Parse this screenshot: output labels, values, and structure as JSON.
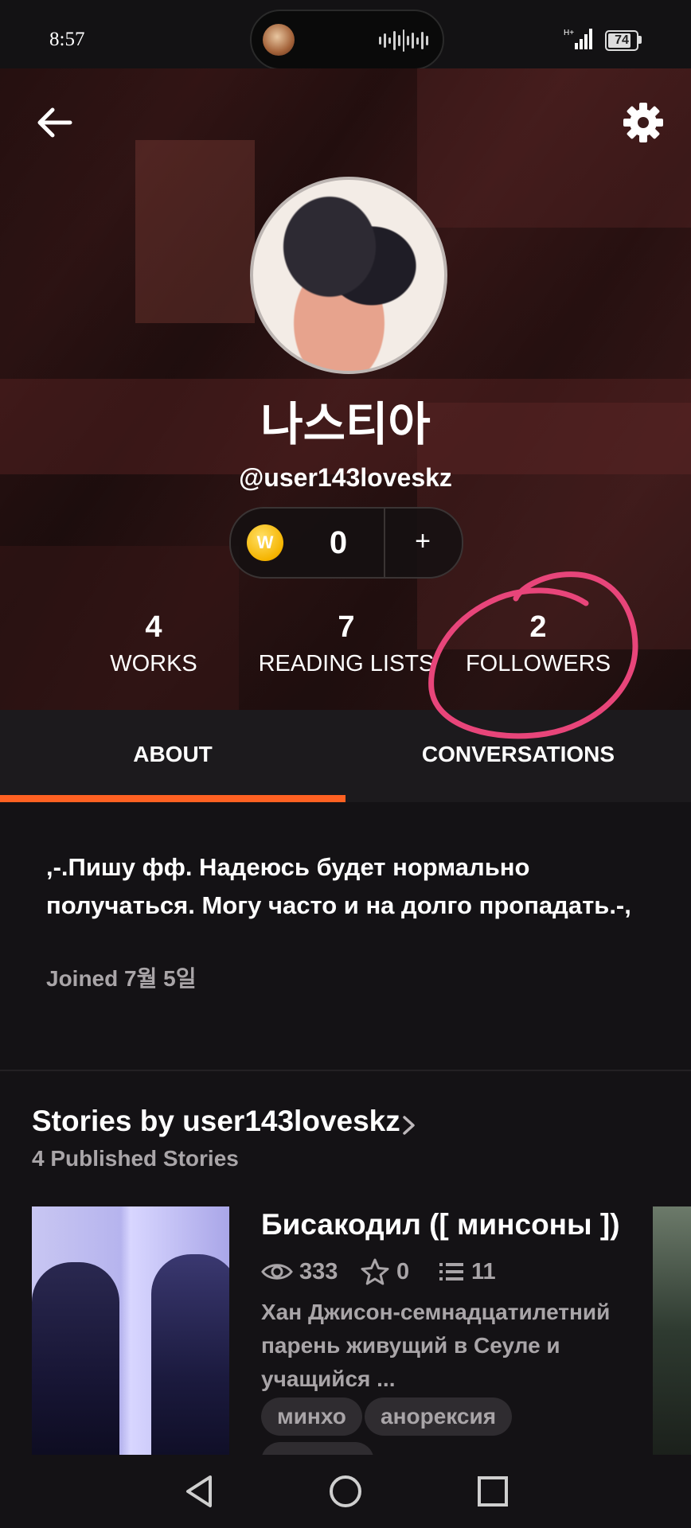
{
  "status_bar": {
    "time": "8:57",
    "network": "H+",
    "battery": "74"
  },
  "header": {
    "display_name": "나스티아",
    "username": "@user143loveskz",
    "coin_icon_letter": "W",
    "coins": "0",
    "add_coins_label": "+"
  },
  "stats": [
    {
      "value": "4",
      "label": "WORKS"
    },
    {
      "value": "7",
      "label": "READING LISTS"
    },
    {
      "value": "2",
      "label": "FOLLOWERS"
    }
  ],
  "tabs": [
    {
      "label": "ABOUT",
      "selected": true
    },
    {
      "label": "CONVERSATIONS",
      "selected": false
    }
  ],
  "about": {
    "bio": ",-.Пишу фф. Надеюсь будет нормально получаться. Могу часто и на долго пропадать.-,",
    "joined": "Joined 7월 5일"
  },
  "stories": {
    "title": "Stories by user143loveskz",
    "subtitle": "4 Published Stories",
    "items": [
      {
        "title": "Бисакодил ([ минсоны ])",
        "reads": "333",
        "votes": "0",
        "parts": "11",
        "description": "Хан Джисон-семнадцатилетний парень живущий в Сеуле и учащийся ...",
        "tags": [
          "минхо",
          "анорексия"
        ]
      }
    ]
  },
  "colors": {
    "accent": "#ff6122",
    "annotation": "#e8457a",
    "background": "#141215",
    "coin": "#f5b400"
  },
  "icons": [
    "back-arrow-icon",
    "gear-icon",
    "coin-icon",
    "eye-icon",
    "star-icon",
    "list-icon",
    "chevron-right-icon",
    "nav-back-icon",
    "nav-home-icon",
    "nav-recents-icon"
  ]
}
